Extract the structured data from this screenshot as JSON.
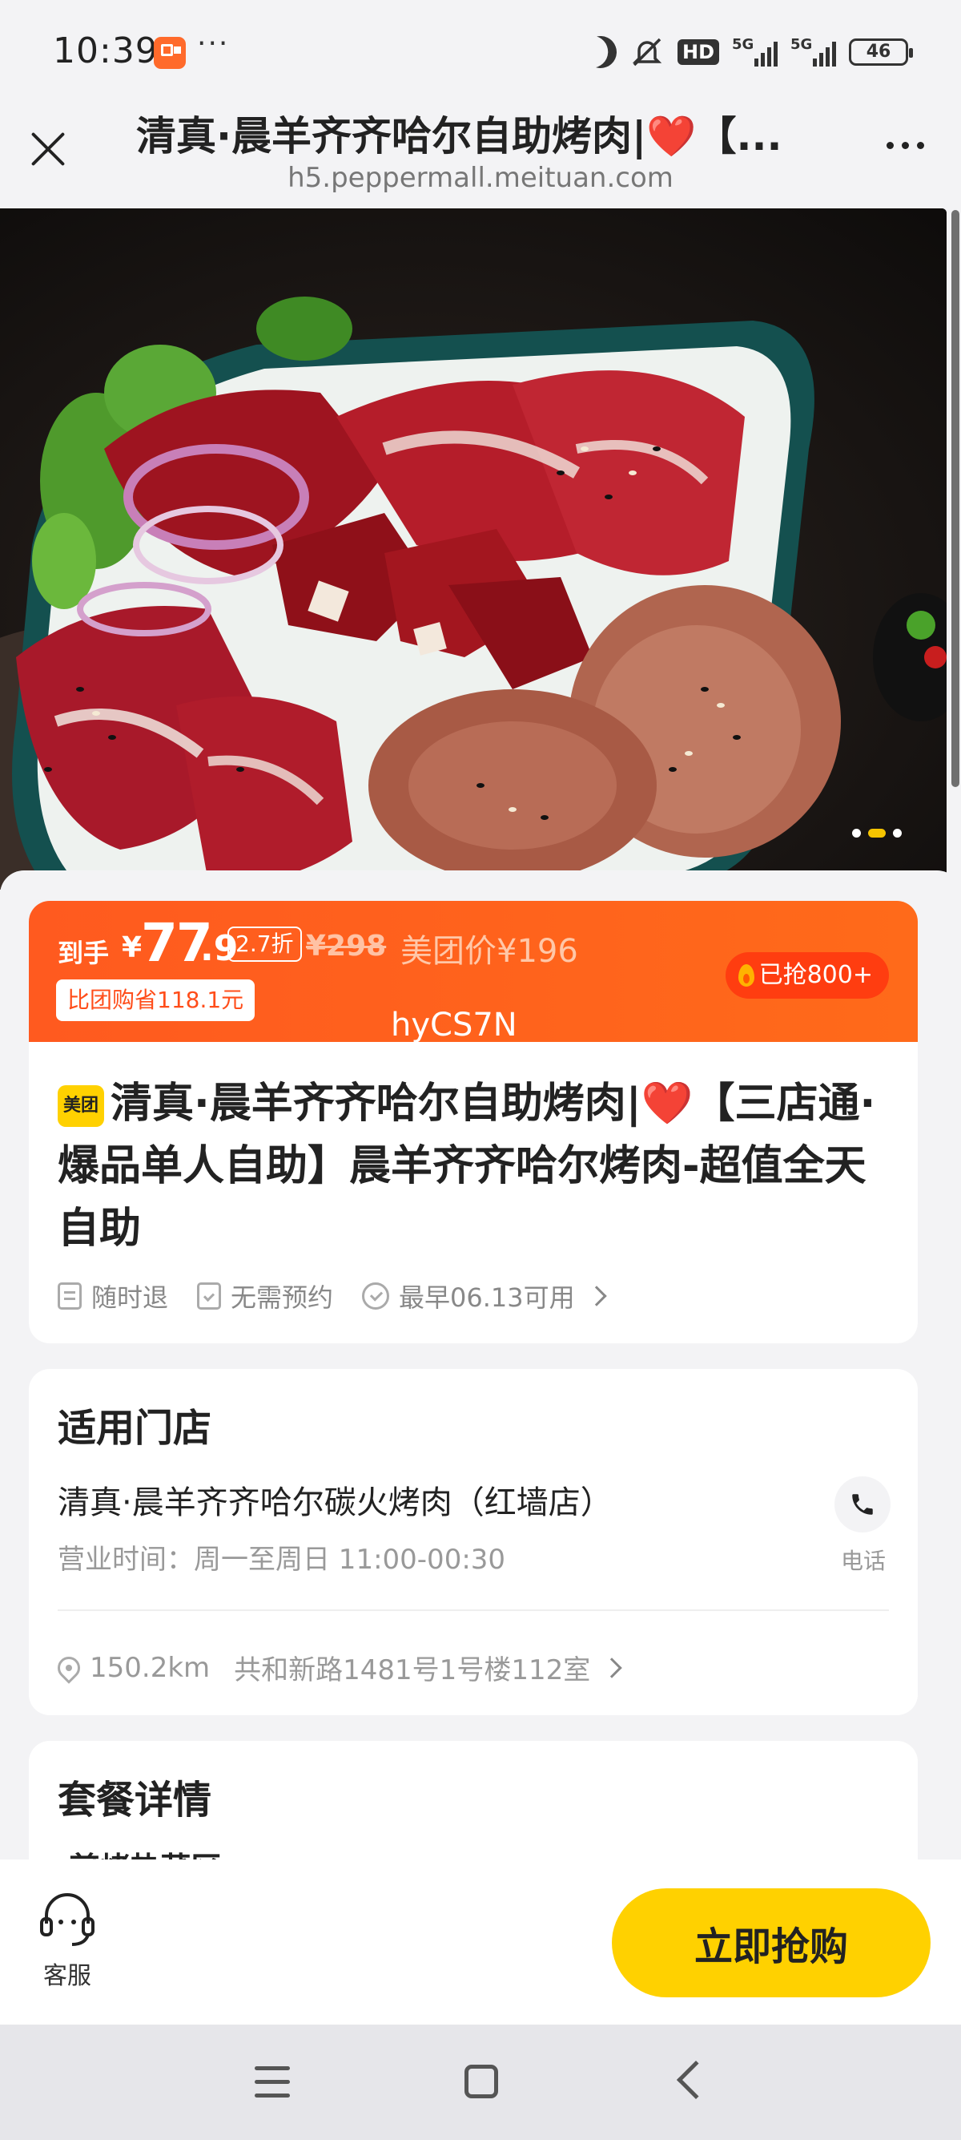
{
  "status_bar": {
    "time": "10:39",
    "more": "···",
    "hd": "HD",
    "network_1": "5G",
    "network_2": "5G",
    "battery": "46"
  },
  "title_bar": {
    "title": "清真·晨羊齐齐哈尔自助烤肉|❤️【...",
    "url": "h5.peppermall.meituan.com"
  },
  "price_banner": {
    "prefix": "到手",
    "currency": "¥",
    "price_int": "77",
    "price_dec": ".9",
    "discount": "2.7折",
    "original_price": "¥298",
    "meituan_price": "美团价¥196",
    "save_note": "比团购省118.1元",
    "grabbed": "已抢800+"
  },
  "overlay_code": "hyCS7N",
  "product": {
    "brand_badge": "美团",
    "title_part1": "清真·晨羊齐齐哈尔自助烤肉|",
    "heart": "❤️",
    "title_part2": "【三店通·爆品单人自助】晨羊齐齐哈尔烤肉-超值全天自助",
    "features": [
      "随时退",
      "无需预约",
      "最早06.13可用"
    ]
  },
  "store": {
    "section_title": "适用门店",
    "name": "清真·晨羊齐齐哈尔碳火烤肉（红墙店）",
    "hours": "营业时间：周一至周日 11:00-00:30",
    "phone_label": "电话",
    "distance": "150.2km",
    "address": "共和新路1481号1号楼112室"
  },
  "package": {
    "section_title": "套餐详情",
    "subsection": "·煎烤热菜区"
  },
  "action_bar": {
    "service_label": "客服",
    "buy_label": "立即抢购"
  },
  "colors": {
    "accent_orange": "#ff5a1f",
    "meituan_yellow": "#ffd100"
  }
}
